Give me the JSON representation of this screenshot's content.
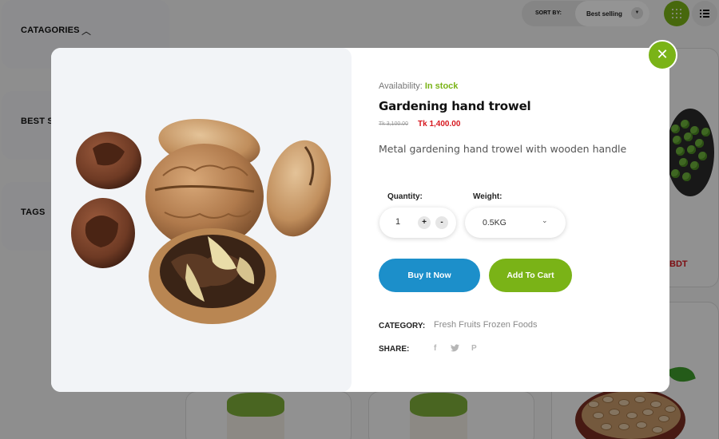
{
  "sidebar": {
    "categories_label": "CATAGORIES",
    "best_selling_label": "BEST SE",
    "tags_label": "TAGS"
  },
  "toolbar": {
    "sort_label": "SORT BY:",
    "sort_value": "Best selling"
  },
  "background": {
    "price_fragment": "BDT"
  },
  "modal": {
    "availability_label": "Availability:",
    "availability_value": "In stock",
    "title": "Gardening hand trowel",
    "old_price": "Tk 3,100.00",
    "new_price": "Tk 1,400.00",
    "description": "Metal gardening hand trowel with wooden handle",
    "quantity_label": "Quantity:",
    "quantity_value": "1",
    "quantity_plus": "+",
    "quantity_minus": "-",
    "weight_label": "Weight:",
    "weight_value": "0.5KG",
    "buy_now_label": "Buy It Now",
    "add_to_cart_label": "Add To Cart",
    "category_label": "CATEGORY:",
    "categories": [
      "Fresh Fruits",
      "Frozen Foods"
    ],
    "share_label": "SHARE:",
    "close_icon": "close-icon"
  },
  "colors": {
    "accent_green": "#7ab317",
    "buy_blue": "#1c8fca",
    "price_red": "#d71920"
  }
}
